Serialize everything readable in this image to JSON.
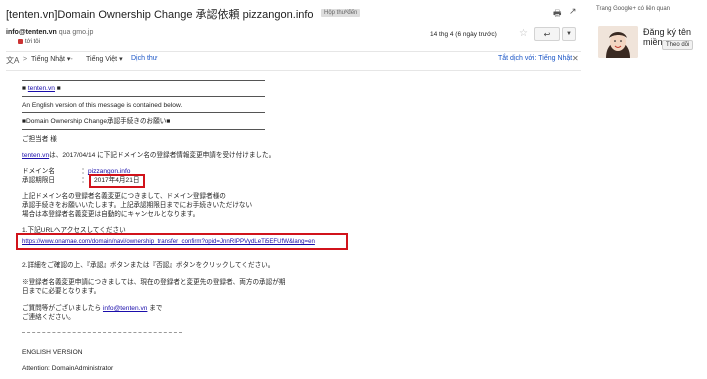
{
  "header": {
    "subject": "[tenten.vn]Domain Ownership Change 承認依頼 pizzangon.info",
    "inbox_label": "Hộp thư đến",
    "inbox_close": "x"
  },
  "message": {
    "sender_email": "info@tenten.vn",
    "via_text": "qua gmo.jp",
    "to_text": "tới tôi",
    "date": "14 thg 4 (6 ngày trước)",
    "translate_from": "Tiếng Nhật",
    "translate_arrow": ">",
    "translate_to": "Tiếng Việt",
    "translate_action": "Dịch thư",
    "translate_off": "Tắt dịch với: Tiếng Nhật"
  },
  "email_body": {
    "domain_link_prefix": "■ ",
    "domain_link": "tenten.vn",
    "domain_link_suffix": " ■",
    "english_notice": "An English version of this message is contained below.",
    "title_line": "■Domain Ownership Change承認手続きのお願い■",
    "greeting": "ご担当者 様",
    "intro_link": "tenten.vn",
    "intro_rest": "は、2017/04/14 に下記ドメイン名の登録者情報変更申請を受け付けました。",
    "domain_label": "ドメイン名　　　　：",
    "domain_value": "pizzangon.info",
    "deadline_label": "承認期限日　　　　：",
    "deadline_value": "2017年4月21日",
    "para1_line1": "上記ドメイン名の登録者名義変更につきまして、ドメイン登録者様の",
    "para1_line2": "承認手続きをお願いいたします。上記承認期限日までにお手続きいただけない",
    "para1_line3": "場合は本登録者名義変更は自動的にキャンセルとなります。",
    "step1": "1.下記URLへアクセスしてください",
    "approval_url": "https://www.onamae.com/domain/navi/ownership_transfer_confirm?opid=JnnRIPPVydLeTi5EFUfW&lang=en",
    "step2": "2.詳細をご確認の上、『承認』ボタンまたは『否認』ボタンをクリックしてください。",
    "note_line1": "※登録者名義変更申請につきましては、現在の登録者と変更先の登録者、両方の承認が期",
    "note_line2": "日までに必要となります。",
    "contact_line1_pre": "ご質問等がございましたら ",
    "contact_email": "info@tenten.vn",
    "contact_line1_post": " まで",
    "contact_line2": "ご連絡ください。",
    "english_heading": "ENGLISH VERSION",
    "attention": "Attention: DomainAdministrator"
  },
  "sidebar": {
    "title": "Trang Google+ có liên quan",
    "contact_name": "Đăng ký tên miền",
    "follow_label": "Theo dõi"
  },
  "icons": {
    "print": "print-icon",
    "newwindow": "open-new-window-icon",
    "star": "star-icon",
    "reply": "reply-icon",
    "more": "chevron-down-icon",
    "translate": "translate-icon",
    "close": "close-icon",
    "lock": "lock-icon"
  },
  "colors": {
    "highlight_red": "#d1131b",
    "link_blue": "#1a0dab"
  }
}
